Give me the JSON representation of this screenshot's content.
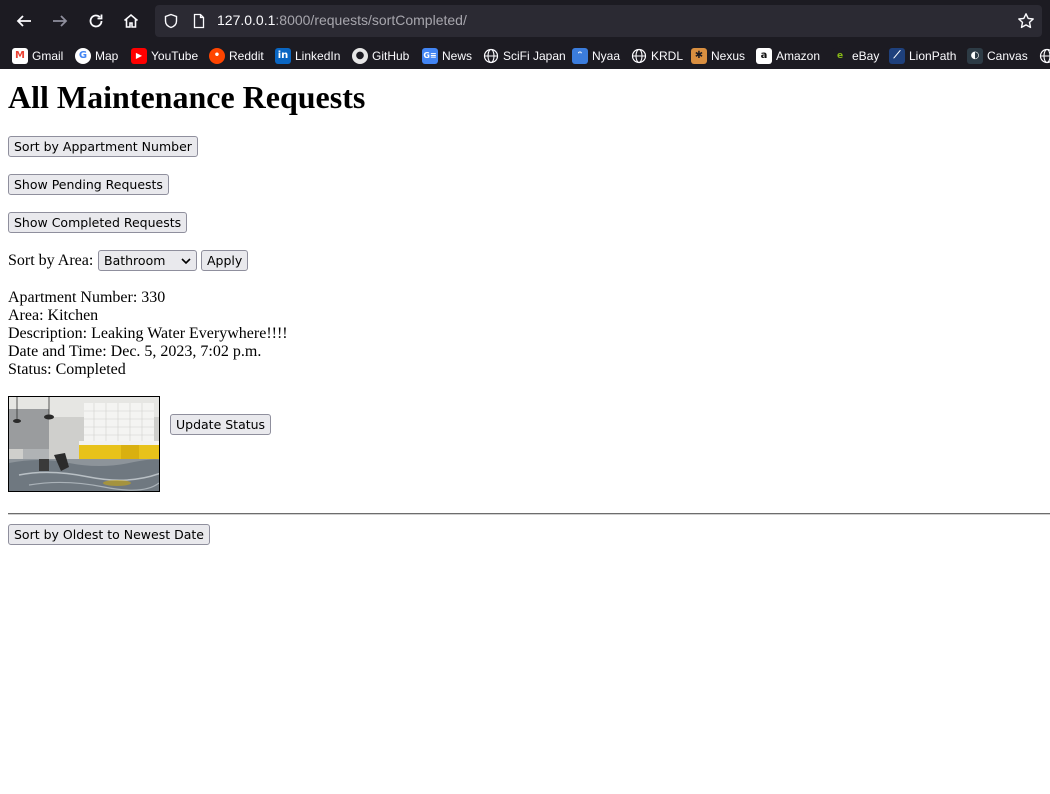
{
  "browser": {
    "url_host": "127.0.0.1",
    "url_path": ":8000/requests/sortCompleted/",
    "bookmarks": [
      {
        "label": "Gmail",
        "icon": "gmail-icon"
      },
      {
        "label": "Map",
        "icon": "google-icon"
      },
      {
        "label": "YouTube",
        "icon": "youtube-icon"
      },
      {
        "label": "Reddit",
        "icon": "reddit-icon"
      },
      {
        "label": "LinkedIn",
        "icon": "linkedin-icon"
      },
      {
        "label": "GitHub",
        "icon": "github-icon"
      },
      {
        "label": "News",
        "icon": "google-news-icon"
      },
      {
        "label": "SciFi Japan",
        "icon": "globe-icon"
      },
      {
        "label": "Nyaa",
        "icon": "nyaa-icon"
      },
      {
        "label": "KRDL",
        "icon": "globe-icon"
      },
      {
        "label": "Nexus",
        "icon": "nexus-icon"
      },
      {
        "label": "Amazon",
        "icon": "amazon-icon"
      },
      {
        "label": "eBay",
        "icon": "ebay-icon"
      },
      {
        "label": "LionPath",
        "icon": "lionpath-icon"
      },
      {
        "label": "Canvas",
        "icon": "canvas-icon"
      }
    ]
  },
  "page": {
    "title": "All Maintenance Requests",
    "buttons": {
      "sort_apartment": "Sort by Appartment Number",
      "show_pending": "Show Pending Requests",
      "show_completed": "Show Completed Requests",
      "apply": "Apply",
      "update_status": "Update Status",
      "sort_date": "Sort by Oldest to Newest Date"
    },
    "sort_area": {
      "label": "Sort by Area:",
      "selected": "Bathroom"
    },
    "request": {
      "apartment": "Apartment Number: 330",
      "area": "Area: Kitchen",
      "description": "Description: Leaking Water Everywhere!!!!",
      "datetime": "Date and Time: Dec. 5, 2023, 7:02 p.m.",
      "status": "Status: Completed"
    }
  }
}
